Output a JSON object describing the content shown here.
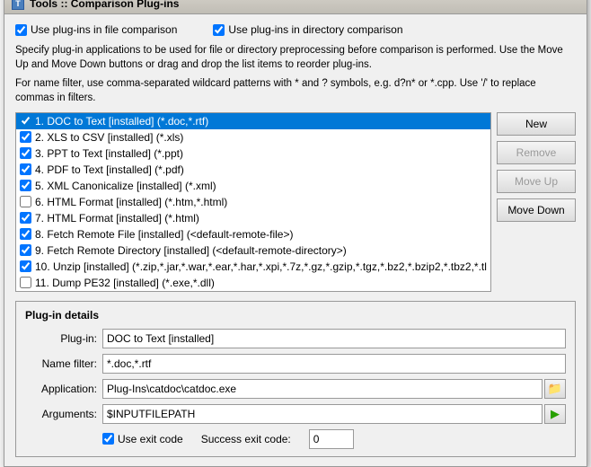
{
  "window": {
    "title": "Tools :: Comparison Plug-ins"
  },
  "checkboxes": {
    "use_plugins_file": {
      "label": "Use plug-ins in file comparison",
      "checked": true
    },
    "use_plugins_dir": {
      "label": "Use plug-ins in directory comparison",
      "checked": true
    }
  },
  "info_text1": "Specify plug-in applications to be used for file or directory preprocessing before comparison is performed. Use the Move Up and Move Down buttons or drag and drop the list items to reorder plug-ins.",
  "info_text2": "For name filter, use comma-separated wildcard patterns with * and ? symbols, e.g. d?n* or *.cpp. Use '/' to replace commas in filters.",
  "list_items": [
    {
      "id": 1,
      "checked": true,
      "label": "1. DOC to Text [installed] (*.doc,*.rtf)",
      "selected": true
    },
    {
      "id": 2,
      "checked": true,
      "label": "2. XLS to CSV [installed] (*.xls)",
      "selected": false
    },
    {
      "id": 3,
      "checked": true,
      "label": "3. PPT to Text [installed] (*.ppt)",
      "selected": false
    },
    {
      "id": 4,
      "checked": true,
      "label": "4. PDF to Text [installed] (*.pdf)",
      "selected": false
    },
    {
      "id": 5,
      "checked": true,
      "label": "5. XML Canonicalize [installed] (*.xml)",
      "selected": false
    },
    {
      "id": 6,
      "checked": false,
      "label": "6. HTML Format [installed] (*.htm,*.html)",
      "selected": false
    },
    {
      "id": 7,
      "checked": true,
      "label": "7. HTML Format [installed] (*.html)",
      "selected": false
    },
    {
      "id": 8,
      "checked": true,
      "label": "8. Fetch Remote File [installed] (<default-remote-file>)",
      "selected": false
    },
    {
      "id": 9,
      "checked": true,
      "label": "9. Fetch Remote Directory [installed] (<default-remote-directory>)",
      "selected": false
    },
    {
      "id": 10,
      "checked": true,
      "label": "10. Unzip [installed] (*.zip,*.jar,*.war,*.ear,*.har,*.xpi,*.7z,*.gz,*.gzip,*.tgz,*.bz2,*.bzip2,*.tbz2,*.tl",
      "selected": false
    },
    {
      "id": 11,
      "checked": false,
      "label": "11. Dump PE32 [installed] (*.exe,*.dll)",
      "selected": false
    }
  ],
  "buttons": {
    "new": "New",
    "remove": "Remove",
    "move_up": "Move Up",
    "move_down": "Move Down"
  },
  "plugin_details": {
    "title": "Plug-in details",
    "plugin_in_label": "Plug-in:",
    "plugin_in_value": "DOC to Text [installed]",
    "name_filter_label": "Name filter:",
    "name_filter_value": "*.doc,*.rtf",
    "application_label": "Application:",
    "application_value": "Plug-Ins\\catdoc\\catdoc.exe",
    "arguments_label": "Arguments:",
    "arguments_value": "$INPUTFILEPATH",
    "use_exit_code_label": "Use exit code",
    "success_exit_code_label": "Success exit code:",
    "success_exit_code_value": "0",
    "folder_icon": "📁",
    "play_icon": "▶"
  }
}
